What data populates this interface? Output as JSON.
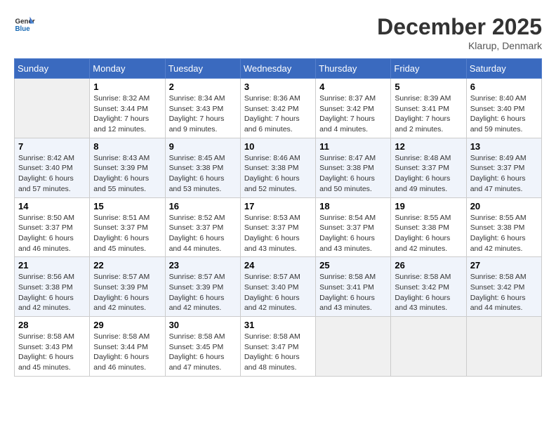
{
  "header": {
    "logo_line1": "General",
    "logo_line2": "Blue",
    "month_title": "December 2025",
    "location": "Klarup, Denmark"
  },
  "days_of_week": [
    "Sunday",
    "Monday",
    "Tuesday",
    "Wednesday",
    "Thursday",
    "Friday",
    "Saturday"
  ],
  "weeks": [
    [
      {
        "day": "",
        "sunrise": "",
        "sunset": "",
        "daylight": ""
      },
      {
        "day": "1",
        "sunrise": "Sunrise: 8:32 AM",
        "sunset": "Sunset: 3:44 PM",
        "daylight": "Daylight: 7 hours and 12 minutes."
      },
      {
        "day": "2",
        "sunrise": "Sunrise: 8:34 AM",
        "sunset": "Sunset: 3:43 PM",
        "daylight": "Daylight: 7 hours and 9 minutes."
      },
      {
        "day": "3",
        "sunrise": "Sunrise: 8:36 AM",
        "sunset": "Sunset: 3:42 PM",
        "daylight": "Daylight: 7 hours and 6 minutes."
      },
      {
        "day": "4",
        "sunrise": "Sunrise: 8:37 AM",
        "sunset": "Sunset: 3:42 PM",
        "daylight": "Daylight: 7 hours and 4 minutes."
      },
      {
        "day": "5",
        "sunrise": "Sunrise: 8:39 AM",
        "sunset": "Sunset: 3:41 PM",
        "daylight": "Daylight: 7 hours and 2 minutes."
      },
      {
        "day": "6",
        "sunrise": "Sunrise: 8:40 AM",
        "sunset": "Sunset: 3:40 PM",
        "daylight": "Daylight: 6 hours and 59 minutes."
      }
    ],
    [
      {
        "day": "7",
        "sunrise": "Sunrise: 8:42 AM",
        "sunset": "Sunset: 3:40 PM",
        "daylight": "Daylight: 6 hours and 57 minutes."
      },
      {
        "day": "8",
        "sunrise": "Sunrise: 8:43 AM",
        "sunset": "Sunset: 3:39 PM",
        "daylight": "Daylight: 6 hours and 55 minutes."
      },
      {
        "day": "9",
        "sunrise": "Sunrise: 8:45 AM",
        "sunset": "Sunset: 3:38 PM",
        "daylight": "Daylight: 6 hours and 53 minutes."
      },
      {
        "day": "10",
        "sunrise": "Sunrise: 8:46 AM",
        "sunset": "Sunset: 3:38 PM",
        "daylight": "Daylight: 6 hours and 52 minutes."
      },
      {
        "day": "11",
        "sunrise": "Sunrise: 8:47 AM",
        "sunset": "Sunset: 3:38 PM",
        "daylight": "Daylight: 6 hours and 50 minutes."
      },
      {
        "day": "12",
        "sunrise": "Sunrise: 8:48 AM",
        "sunset": "Sunset: 3:37 PM",
        "daylight": "Daylight: 6 hours and 49 minutes."
      },
      {
        "day": "13",
        "sunrise": "Sunrise: 8:49 AM",
        "sunset": "Sunset: 3:37 PM",
        "daylight": "Daylight: 6 hours and 47 minutes."
      }
    ],
    [
      {
        "day": "14",
        "sunrise": "Sunrise: 8:50 AM",
        "sunset": "Sunset: 3:37 PM",
        "daylight": "Daylight: 6 hours and 46 minutes."
      },
      {
        "day": "15",
        "sunrise": "Sunrise: 8:51 AM",
        "sunset": "Sunset: 3:37 PM",
        "daylight": "Daylight: 6 hours and 45 minutes."
      },
      {
        "day": "16",
        "sunrise": "Sunrise: 8:52 AM",
        "sunset": "Sunset: 3:37 PM",
        "daylight": "Daylight: 6 hours and 44 minutes."
      },
      {
        "day": "17",
        "sunrise": "Sunrise: 8:53 AM",
        "sunset": "Sunset: 3:37 PM",
        "daylight": "Daylight: 6 hours and 43 minutes."
      },
      {
        "day": "18",
        "sunrise": "Sunrise: 8:54 AM",
        "sunset": "Sunset: 3:37 PM",
        "daylight": "Daylight: 6 hours and 43 minutes."
      },
      {
        "day": "19",
        "sunrise": "Sunrise: 8:55 AM",
        "sunset": "Sunset: 3:38 PM",
        "daylight": "Daylight: 6 hours and 42 minutes."
      },
      {
        "day": "20",
        "sunrise": "Sunrise: 8:55 AM",
        "sunset": "Sunset: 3:38 PM",
        "daylight": "Daylight: 6 hours and 42 minutes."
      }
    ],
    [
      {
        "day": "21",
        "sunrise": "Sunrise: 8:56 AM",
        "sunset": "Sunset: 3:38 PM",
        "daylight": "Daylight: 6 hours and 42 minutes."
      },
      {
        "day": "22",
        "sunrise": "Sunrise: 8:57 AM",
        "sunset": "Sunset: 3:39 PM",
        "daylight": "Daylight: 6 hours and 42 minutes."
      },
      {
        "day": "23",
        "sunrise": "Sunrise: 8:57 AM",
        "sunset": "Sunset: 3:39 PM",
        "daylight": "Daylight: 6 hours and 42 minutes."
      },
      {
        "day": "24",
        "sunrise": "Sunrise: 8:57 AM",
        "sunset": "Sunset: 3:40 PM",
        "daylight": "Daylight: 6 hours and 42 minutes."
      },
      {
        "day": "25",
        "sunrise": "Sunrise: 8:58 AM",
        "sunset": "Sunset: 3:41 PM",
        "daylight": "Daylight: 6 hours and 43 minutes."
      },
      {
        "day": "26",
        "sunrise": "Sunrise: 8:58 AM",
        "sunset": "Sunset: 3:42 PM",
        "daylight": "Daylight: 6 hours and 43 minutes."
      },
      {
        "day": "27",
        "sunrise": "Sunrise: 8:58 AM",
        "sunset": "Sunset: 3:42 PM",
        "daylight": "Daylight: 6 hours and 44 minutes."
      }
    ],
    [
      {
        "day": "28",
        "sunrise": "Sunrise: 8:58 AM",
        "sunset": "Sunset: 3:43 PM",
        "daylight": "Daylight: 6 hours and 45 minutes."
      },
      {
        "day": "29",
        "sunrise": "Sunrise: 8:58 AM",
        "sunset": "Sunset: 3:44 PM",
        "daylight": "Daylight: 6 hours and 46 minutes."
      },
      {
        "day": "30",
        "sunrise": "Sunrise: 8:58 AM",
        "sunset": "Sunset: 3:45 PM",
        "daylight": "Daylight: 6 hours and 47 minutes."
      },
      {
        "day": "31",
        "sunrise": "Sunrise: 8:58 AM",
        "sunset": "Sunset: 3:47 PM",
        "daylight": "Daylight: 6 hours and 48 minutes."
      },
      {
        "day": "",
        "sunrise": "",
        "sunset": "",
        "daylight": ""
      },
      {
        "day": "",
        "sunrise": "",
        "sunset": "",
        "daylight": ""
      },
      {
        "day": "",
        "sunrise": "",
        "sunset": "",
        "daylight": ""
      }
    ]
  ]
}
